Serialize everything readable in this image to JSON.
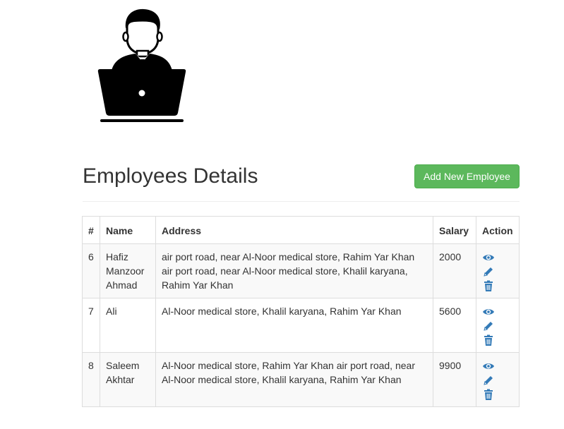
{
  "header": {
    "logo_icon": "employee-at-laptop-icon"
  },
  "page": {
    "title": "Employees Details",
    "add_button_label": "Add New Employee",
    "accent_color": "#5cb85c",
    "icon_color": "#337ab7"
  },
  "table": {
    "columns": [
      "#",
      "Name",
      "Address",
      "Salary",
      "Action"
    ],
    "rows": [
      {
        "id": "6",
        "name": "Hafiz Manzoor Ahmad",
        "address": "air port road, near Al-Noor medical store, Rahim Yar Khan air port road, near Al-Noor medical store, Khalil karyana, Rahim Yar Khan",
        "salary": "2000",
        "actions": [
          "view-icon",
          "edit-icon",
          "delete-icon"
        ]
      },
      {
        "id": "7",
        "name": "Ali",
        "address": "Al-Noor medical store, Khalil karyana, Rahim Yar Khan",
        "salary": "5600",
        "actions": [
          "view-icon",
          "edit-icon",
          "delete-icon"
        ]
      },
      {
        "id": "8",
        "name": "Saleem Akhtar",
        "address": "Al-Noor medical store, Rahim Yar Khan air port road, near Al-Noor medical store, Khalil karyana, Rahim Yar Khan",
        "salary": "9900",
        "actions": [
          "view-icon",
          "edit-icon",
          "delete-icon"
        ]
      }
    ]
  }
}
